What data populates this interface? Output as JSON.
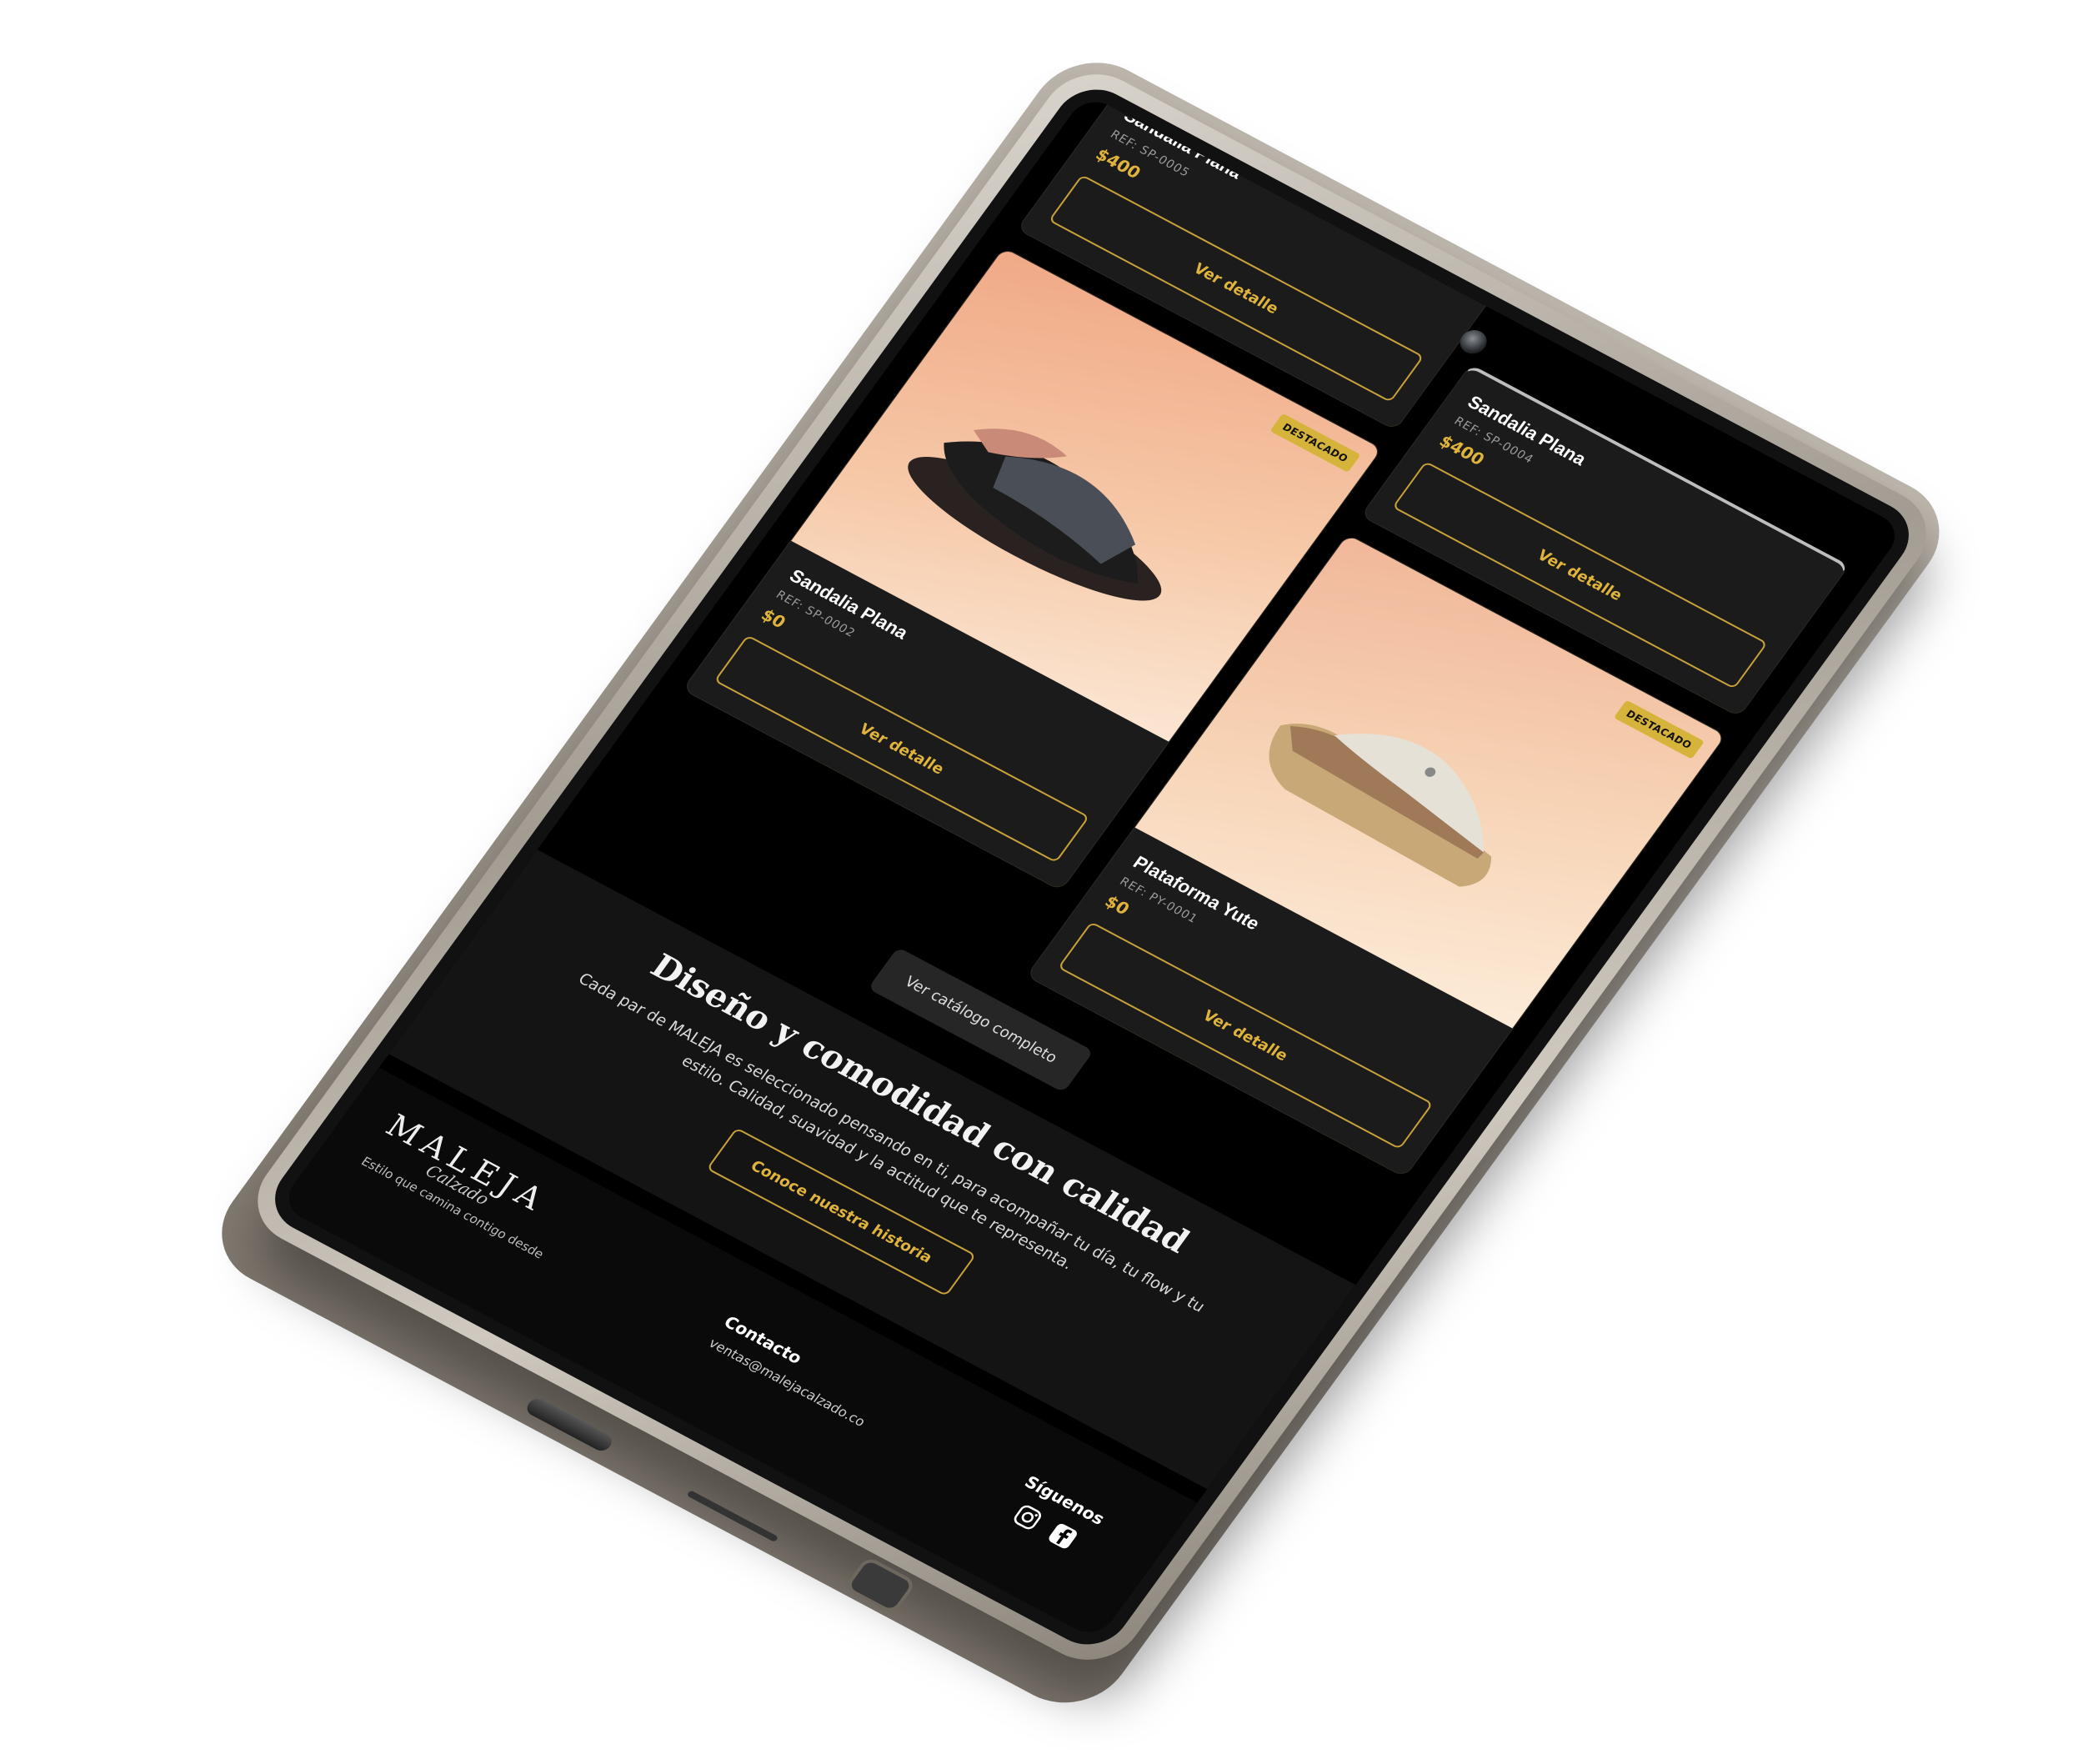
{
  "products": [
    {
      "name": "Sandalia Plana",
      "ref": "REF: SP-0005",
      "price": "$400",
      "button": "Ver detalle"
    },
    {
      "name": "Sandalia Plana",
      "ref": "REF: SP-0004",
      "price": "$400",
      "button": "Ver detalle"
    },
    {
      "name": "Sandalia Plana",
      "ref": "REF: SP-0002",
      "price": "$0",
      "button": "Ver detalle",
      "badge": "DESTACADO"
    },
    {
      "name": "Plataforma Yute",
      "ref": "REF: PY-0001",
      "price": "$0",
      "button": "Ver detalle",
      "badge": "DESTACADO"
    }
  ],
  "catalog_button": "Ver catálogo completo",
  "story": {
    "title": "Diseño y comodidad con calidad",
    "body": "Cada par de MALEJA es seleccionado pensando en ti, para acompañar tu día, tu flow y tu estilo. Calidad, suavidad y la actitud que te representa.",
    "cta": "Conoce nuestra historia"
  },
  "footer": {
    "logo": "MALEJA",
    "logo_sub": "Calzado",
    "tagline": "Estilo que camina contigo desde",
    "contact_title": "Contacto",
    "email": "ventas@malejacalzado.co",
    "follow_title": "Síguenos",
    "social_icons": [
      "instagram-icon",
      "facebook-icon"
    ]
  },
  "colors": {
    "accent": "#e0b43c",
    "background": "#000000",
    "card": "#1b1b1b"
  }
}
